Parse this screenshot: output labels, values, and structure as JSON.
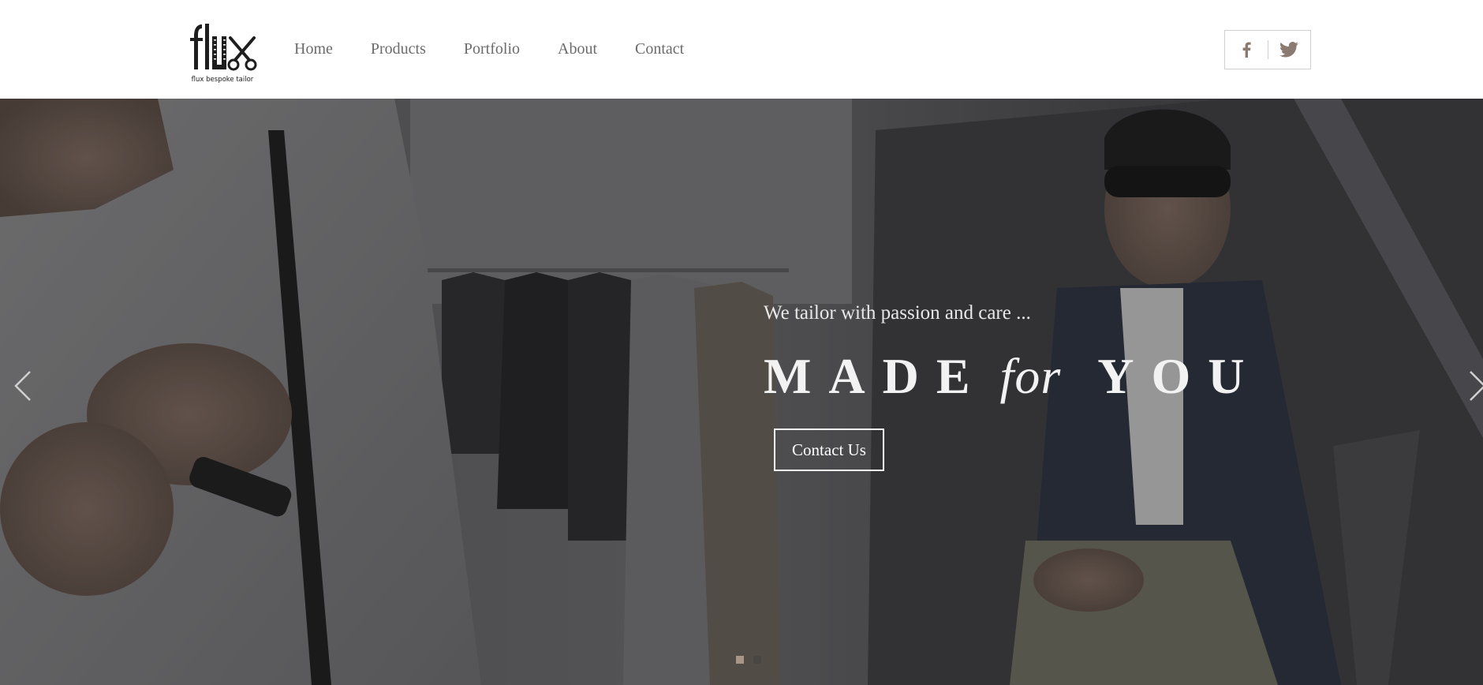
{
  "brand": {
    "logo_text": "flux bespoke tailor",
    "logo_icon": "scissors-icon"
  },
  "nav": {
    "items": [
      {
        "label": "Home"
      },
      {
        "label": "Products"
      },
      {
        "label": "Portfolio"
      },
      {
        "label": "About"
      },
      {
        "label": "Contact"
      }
    ]
  },
  "social": {
    "facebook_icon": "facebook-icon",
    "twitter_icon": "twitter-icon"
  },
  "hero": {
    "tagline": "We tailor with passion and care ...",
    "headline_part1": "MADE",
    "headline_part2": "for",
    "headline_part3": "YOU",
    "cta_label": "Contact Us",
    "prev_icon": "chevron-left-icon",
    "next_icon": "chevron-right-icon",
    "slides_total": 2,
    "active_slide": 1
  },
  "colors": {
    "accent": "#a89583",
    "nav_text": "#6b6b6b",
    "social_icon": "#8a7a70"
  }
}
